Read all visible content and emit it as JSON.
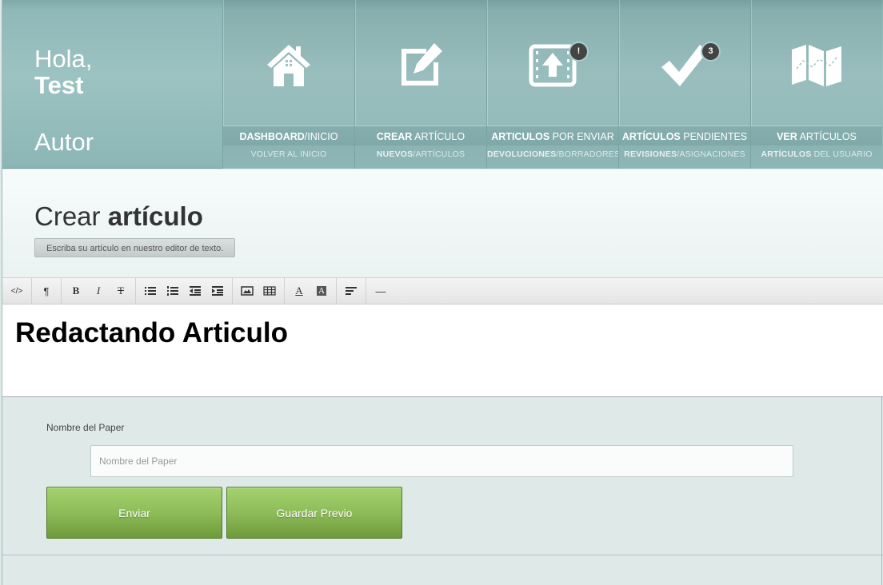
{
  "user": {
    "greeting": "Hola,",
    "name": "Test",
    "role": "Autor"
  },
  "nav": [
    {
      "icon": "home-icon",
      "title_bold": "DASHBOARD",
      "title_rest": "/INICIO",
      "sub_bold": "",
      "sub_rest": "VOLVER AL INICIO",
      "badge": ""
    },
    {
      "icon": "edit-icon",
      "title_bold": "CREAR",
      "title_rest": " ARTÍCULO",
      "sub_bold": "NUEVOS",
      "sub_rest": "/ARTÍCULOS",
      "badge": ""
    },
    {
      "icon": "upload-icon",
      "title_bold": "ARTICULOS",
      "title_rest": " POR ENVIAR",
      "sub_bold": "DEVOLUCIONES",
      "sub_rest": "/BORRADORES",
      "badge": "!"
    },
    {
      "icon": "checkmark-icon",
      "title_bold": "ARTÍCULOS",
      "title_rest": " PENDIENTES",
      "sub_bold": "REVISIONES",
      "sub_rest": "/ASIGNACIONES",
      "badge": "3"
    },
    {
      "icon": "map-icon",
      "title_bold": "VER",
      "title_rest": " ARTÍCULOS",
      "sub_bold": "ARTÍCULOS",
      "sub_rest": " DEL USUARIO",
      "badge": ""
    }
  ],
  "page": {
    "title_light": "Crear ",
    "title_bold": "artículo",
    "subtitle": "Escriba su artículo en nuestro editor de texto."
  },
  "toolbar": {
    "html": "</>",
    "paragraph": "¶",
    "bold": "B",
    "italic": "I",
    "strike": "T",
    "font_color": "A",
    "highlight": "A",
    "hr": "—"
  },
  "editor": {
    "content": "Redactando Articulo"
  },
  "form": {
    "name_label": "Nombre del Paper",
    "name_placeholder": "Nombre del Paper",
    "name_value": "",
    "send_label": "Enviar",
    "save_label": "Guardar Previo"
  }
}
